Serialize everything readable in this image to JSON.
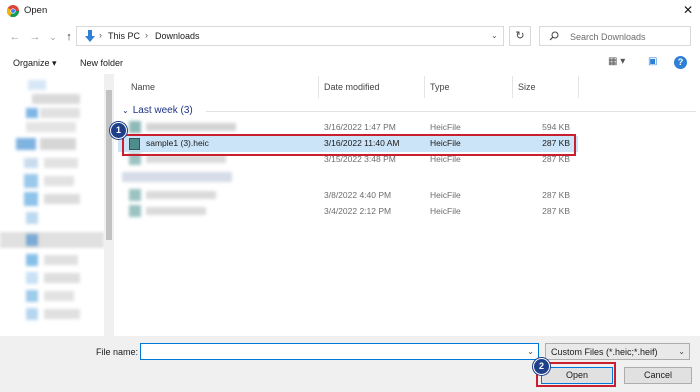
{
  "window": {
    "title": "Open",
    "close_glyph": "✕",
    "app_icon": "chrome-icon"
  },
  "address": {
    "back_glyph": "←",
    "forward_glyph": "→",
    "recent_glyph": "⌄",
    "up_glyph": "↑",
    "path": [
      "This PC",
      "Downloads"
    ],
    "separator": "›",
    "dropdown_glyph": "⌄",
    "refresh_glyph": "↻",
    "search_placeholder": "Search Downloads",
    "search_icon": "search-icon"
  },
  "toolbar": {
    "organize_label": "Organize ▾",
    "new_folder_label": "New folder",
    "view_glyph": "▦ ▾",
    "preview_glyph": "▣",
    "help_glyph": "?"
  },
  "columns": [
    "Name",
    "Date modified",
    "Type",
    "Size"
  ],
  "group": {
    "label": "Last week (3)",
    "arrow": "⌄"
  },
  "files": [
    {
      "name": "",
      "date": "3/16/2022 1:47 PM",
      "type": "HeicFile",
      "size": "594 KB",
      "selected": false
    },
    {
      "name": "sample1 (3).heic",
      "date": "3/16/2022 11:40 AM",
      "type": "HeicFile",
      "size": "287 KB",
      "selected": true
    },
    {
      "name": "",
      "date": "3/15/2022 3:48 PM",
      "type": "HeicFile",
      "size": "287 KB",
      "selected": false
    },
    {
      "name": "",
      "date": "3/8/2022 4:40 PM",
      "type": "HeicFile",
      "size": "287 KB",
      "selected": false
    },
    {
      "name": "",
      "date": "3/4/2022 2:12 PM",
      "type": "HeicFile",
      "size": "287 KB",
      "selected": false
    }
  ],
  "footer": {
    "filename_label": "File name:",
    "filename_value": "",
    "filter_value": "Custom Files (*.heic;*.heif)",
    "dropdown_glyph": "⌄",
    "open_label": "Open",
    "cancel_label": "Cancel"
  },
  "annotations": {
    "step1": "1",
    "step2": "2",
    "highlight_color": "#c8202e",
    "badge_color": "#1f3f8a"
  },
  "colors": {
    "selection": "#cce4f7",
    "accent": "#0078d7",
    "group_header": "#1e3287"
  }
}
